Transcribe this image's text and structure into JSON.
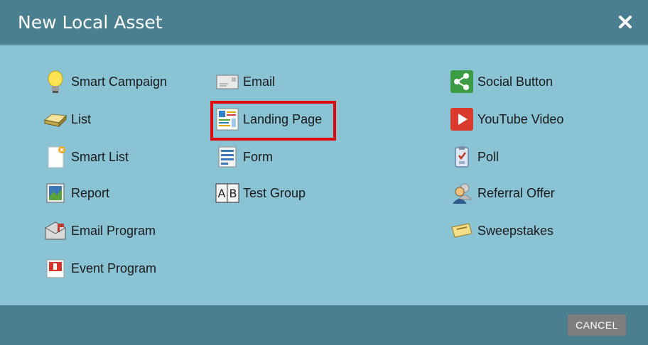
{
  "dialog": {
    "title": "New Local Asset"
  },
  "columns": [
    {
      "items": [
        {
          "label": "Smart Campaign",
          "icon": "lightbulb-icon"
        },
        {
          "label": "List",
          "icon": "list-icon"
        },
        {
          "label": "Smart List",
          "icon": "smart-list-icon"
        },
        {
          "label": "Report",
          "icon": "report-icon"
        },
        {
          "label": "Email Program",
          "icon": "email-program-icon"
        },
        {
          "label": "Event Program",
          "icon": "event-program-icon"
        }
      ]
    },
    {
      "items": [
        {
          "label": "Email",
          "icon": "email-icon"
        },
        {
          "label": "Landing Page",
          "icon": "landing-page-icon",
          "selected": true
        },
        {
          "label": "Form",
          "icon": "form-icon"
        },
        {
          "label": "Test Group",
          "icon": "test-group-icon"
        }
      ]
    },
    {
      "items": [
        {
          "label": "Social Button",
          "icon": "share-icon"
        },
        {
          "label": "YouTube Video",
          "icon": "youtube-icon"
        },
        {
          "label": "Poll",
          "icon": "poll-icon"
        },
        {
          "label": "Referral Offer",
          "icon": "referral-icon"
        },
        {
          "label": "Sweepstakes",
          "icon": "sweepstakes-icon"
        }
      ]
    }
  ],
  "footer": {
    "cancel_label": "CANCEL"
  },
  "colors": {
    "header": "#4a7f90",
    "body": "#8ac3d4",
    "highlight": "#e0080a",
    "cancel": "#7e7e7e"
  }
}
